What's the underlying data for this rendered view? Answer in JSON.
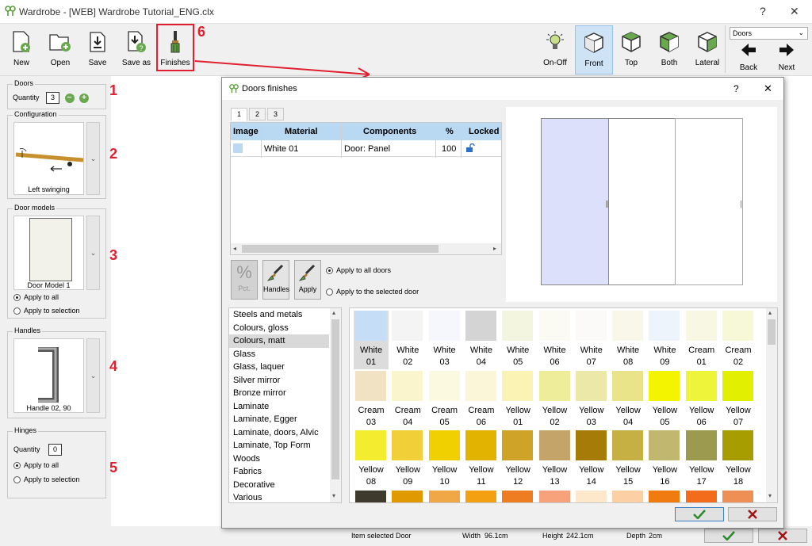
{
  "window": {
    "title": "Wardrobe - [WEB] Wardrobe Tutorial_ENG.clx",
    "help": "?",
    "close": "✕"
  },
  "toolbar": {
    "left": [
      {
        "id": "new",
        "label": "New"
      },
      {
        "id": "open",
        "label": "Open"
      },
      {
        "id": "save",
        "label": "Save"
      },
      {
        "id": "saveas",
        "label": "Save as"
      },
      {
        "id": "finishes",
        "label": "Finishes"
      }
    ],
    "right": [
      {
        "id": "onoff",
        "label": "On-Off"
      },
      {
        "id": "front",
        "label": "Front"
      },
      {
        "id": "top",
        "label": "Top"
      },
      {
        "id": "both",
        "label": "Both"
      },
      {
        "id": "lateral",
        "label": "Lateral"
      }
    ],
    "dropdown_value": "Doors",
    "back": "Back",
    "next": "Next",
    "callout": "6"
  },
  "left": {
    "doors": {
      "title": "Doors",
      "quantity_label": "Quantity",
      "quantity": "3",
      "callout": "1"
    },
    "configuration": {
      "title": "Configuration",
      "caption": "Left swinging",
      "callout": "2"
    },
    "door_models": {
      "title": "Door models",
      "caption": "Door Model 1",
      "opt1": "Apply to all",
      "opt2": "Apply to selection",
      "callout": "3"
    },
    "handles": {
      "title": "Handles",
      "caption": "Handle 02, 90",
      "callout": "4"
    },
    "hinges": {
      "title": "Hinges",
      "quantity_label": "Quantity",
      "quantity": "0",
      "opt1": "Apply to all",
      "opt2": "Apply to selection",
      "callout": "5"
    }
  },
  "status": {
    "item_label": "Item selected",
    "item_value": "Door",
    "width_label": "Width",
    "width_value": "96.1cm",
    "height_label": "Height",
    "height_value": "242.1cm",
    "depth_label": "Depth",
    "depth_value": "2cm"
  },
  "dialog": {
    "title": "Doors finishes",
    "help": "?",
    "close": "✕",
    "tabs": [
      "1",
      "2",
      "3"
    ],
    "grid": {
      "headers": [
        "Image",
        "Material",
        "Components",
        "%",
        "Locked"
      ],
      "rows": [
        {
          "material": "White 01",
          "components": "Door: Panel",
          "percent": "100",
          "color": "#bcd9f4"
        }
      ]
    },
    "buttons": {
      "pct": "Pct.",
      "pct_symbol": "%",
      "handles": "Handles",
      "apply": "Apply"
    },
    "apply_all": "Apply to all doors",
    "apply_selected": "Apply to the selected door",
    "categories": [
      "Steels and metals",
      "Colours, gloss",
      "Colours, matt",
      "Glass",
      "Glass, laquer",
      "Silver mirror",
      "Bronze mirror",
      "Laminate",
      "Laminate, Egger",
      "Laminate, doors, Alvic",
      "Laminate, Top Form",
      "Woods",
      "Fabrics",
      "Decorative",
      "Various"
    ],
    "selected_category": "Colours, matt",
    "swatches": [
      {
        "l1": "White",
        "l2": "01",
        "c": "#c5ddf7"
      },
      {
        "l1": "White",
        "l2": "02",
        "c": "#f4f4f4"
      },
      {
        "l1": "White",
        "l2": "03",
        "c": "#f5f7fc"
      },
      {
        "l1": "White",
        "l2": "04",
        "c": "#d4d4d4"
      },
      {
        "l1": "White",
        "l2": "05",
        "c": "#f3f5de"
      },
      {
        "l1": "White",
        "l2": "06",
        "c": "#fbfbf3"
      },
      {
        "l1": "White",
        "l2": "07",
        "c": "#fcf9f9"
      },
      {
        "l1": "White",
        "l2": "08",
        "c": "#f9f7ea"
      },
      {
        "l1": "White",
        "l2": "09",
        "c": "#eef4fc"
      },
      {
        "l1": "Cream",
        "l2": "01",
        "c": "#f8f7e4"
      },
      {
        "l1": "Cream",
        "l2": "02",
        "c": "#f6f8d8"
      },
      {
        "l1": "Cream",
        "l2": "03",
        "c": "#f0e2c2"
      },
      {
        "l1": "Cream",
        "l2": "04",
        "c": "#fbf5cd"
      },
      {
        "l1": "Cream",
        "l2": "05",
        "c": "#fbfae0"
      },
      {
        "l1": "Cream",
        "l2": "06",
        "c": "#fbf6d8"
      },
      {
        "l1": "Yellow",
        "l2": "01",
        "c": "#fbf3b4"
      },
      {
        "l1": "Yellow",
        "l2": "02",
        "c": "#eded9a"
      },
      {
        "l1": "Yellow",
        "l2": "03",
        "c": "#ece9a8"
      },
      {
        "l1": "Yellow",
        "l2": "04",
        "c": "#e9e48a"
      },
      {
        "l1": "Yellow",
        "l2": "05",
        "c": "#f4f300"
      },
      {
        "l1": "Yellow",
        "l2": "06",
        "c": "#eef43a"
      },
      {
        "l1": "Yellow",
        "l2": "07",
        "c": "#e2f000"
      },
      {
        "l1": "Yellow",
        "l2": "08",
        "c": "#f4ec2e"
      },
      {
        "l1": "Yellow",
        "l2": "09",
        "c": "#f1cf38"
      },
      {
        "l1": "Yellow",
        "l2": "10",
        "c": "#f0d000"
      },
      {
        "l1": "Yellow",
        "l2": "11",
        "c": "#e2b300"
      },
      {
        "l1": "Yellow",
        "l2": "12",
        "c": "#cfa327"
      },
      {
        "l1": "Yellow",
        "l2": "13",
        "c": "#c4a468"
      },
      {
        "l1": "Yellow",
        "l2": "14",
        "c": "#a77b07"
      },
      {
        "l1": "Yellow",
        "l2": "15",
        "c": "#c6b043"
      },
      {
        "l1": "Yellow",
        "l2": "16",
        "c": "#c1b76e"
      },
      {
        "l1": "Yellow",
        "l2": "17",
        "c": "#9b9a4e"
      },
      {
        "l1": "Yellow",
        "l2": "18",
        "c": "#a89d00"
      },
      {
        "l1": "",
        "l2": "",
        "c": "#3f3a2e"
      },
      {
        "l1": "",
        "l2": "",
        "c": "#e09a00"
      },
      {
        "l1": "",
        "l2": "",
        "c": "#f0a846"
      },
      {
        "l1": "",
        "l2": "",
        "c": "#f3a013"
      },
      {
        "l1": "",
        "l2": "",
        "c": "#ee7d22"
      },
      {
        "l1": "",
        "l2": "",
        "c": "#f7a27b"
      },
      {
        "l1": "",
        "l2": "",
        "c": "#fde8cc"
      },
      {
        "l1": "",
        "l2": "",
        "c": "#fcd0a4"
      },
      {
        "l1": "",
        "l2": "",
        "c": "#f07c10"
      },
      {
        "l1": "",
        "l2": "",
        "c": "#f26c1b"
      },
      {
        "l1": "",
        "l2": "",
        "c": "#ee8f55"
      }
    ],
    "selected_swatch": "White 01"
  }
}
